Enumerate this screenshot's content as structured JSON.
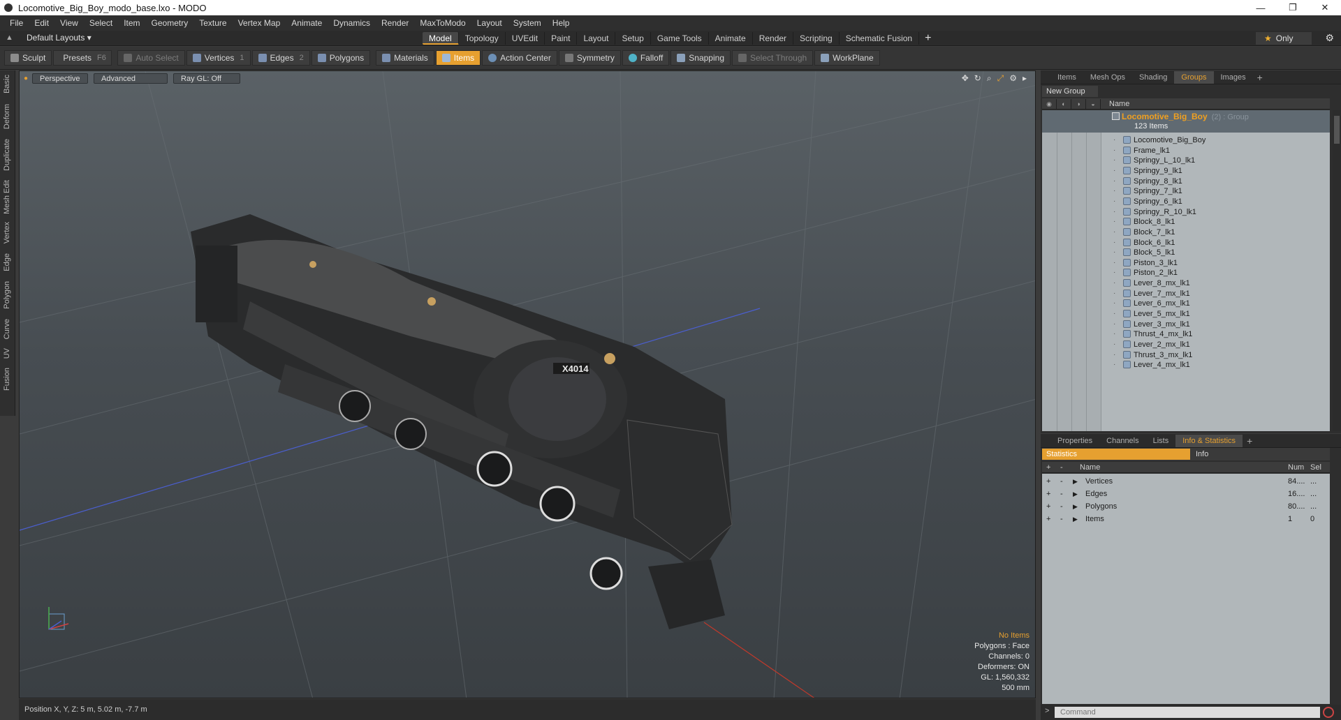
{
  "window": {
    "title": "Locomotive_Big_Boy_modo_base.lxo - MODO",
    "controls": [
      "—",
      "❐",
      "✕"
    ]
  },
  "menubar": [
    "File",
    "Edit",
    "View",
    "Select",
    "Item",
    "Geometry",
    "Texture",
    "Vertex Map",
    "Animate",
    "Dynamics",
    "Render",
    "MaxToModo",
    "Layout",
    "System",
    "Help"
  ],
  "layoutbar": {
    "layout_select": "Default Layouts ▾",
    "tabs": [
      "Model",
      "Topology",
      "UVEdit",
      "Paint",
      "Layout",
      "Setup",
      "Game Tools",
      "Animate",
      "Render",
      "Scripting",
      "Schematic Fusion"
    ],
    "active_tab": "Model",
    "add_tab": "+",
    "only_label": "Only"
  },
  "toolbar": {
    "sculpt": "Sculpt",
    "presets": "Presets",
    "presets_key": "F6",
    "auto_select": "Auto Select",
    "vertices": "Vertices",
    "vertices_key": "1",
    "edges": "Edges",
    "edges_key": "2",
    "polygons": "Polygons",
    "materials": "Materials",
    "items": "Items",
    "action_center": "Action Center",
    "symmetry": "Symmetry",
    "falloff": "Falloff",
    "snapping": "Snapping",
    "select_through": "Select Through",
    "workplane": "WorkPlane"
  },
  "left_tabs": [
    "Basic",
    "Deform",
    "Duplicate",
    "Mesh Edit",
    "Vertex",
    "Edge",
    "Polygon",
    "Curve",
    "UV",
    "Fusion"
  ],
  "viewport": {
    "perspective": "Perspective",
    "advanced": "Advanced",
    "raygl": "Ray GL: Off",
    "model_number": "X4014",
    "info": {
      "no_items": "No Items",
      "polygons": "Polygons : Face",
      "channels": "Channels: 0",
      "deformers": "Deformers: ON",
      "gl": "GL: 1,560,332",
      "scale": "500 mm"
    }
  },
  "statusbar": {
    "position": "Position X, Y, Z:   5 m, 5.02 m, -7.7 m"
  },
  "items_panel": {
    "tabs": [
      "Items",
      "Mesh Ops",
      "Shading",
      "Groups",
      "Images"
    ],
    "active_tab": "Groups",
    "new_group": "New Group",
    "column_name": "Name",
    "group": {
      "name": "Locomotive_Big_Boy",
      "meta": "(2) : Group",
      "count": "123 Items"
    },
    "items": [
      "Locomotive_Big_Boy",
      "Frame_lk1",
      "Springy_L_10_lk1",
      "Springy_9_lk1",
      "Springy_8_lk1",
      "Springy_7_lk1",
      "Springy_6_lk1",
      "Springy_R_10_lk1",
      "Block_8_lk1",
      "Block_7_lk1",
      "Block_6_lk1",
      "Block_5_lk1",
      "Piston_3_lk1",
      "Piston_2_lk1",
      "Lever_8_mx_lk1",
      "Lever_7_mx_lk1",
      "Lever_6_mx_lk1",
      "Lever_5_mx_lk1",
      "Lever_3_mx_lk1",
      "Thrust_4_mx_lk1",
      "Lever_2_mx_lk1",
      "Thrust_3_mx_lk1",
      "Lever_4_mx_lk1"
    ]
  },
  "props_panel": {
    "tabs": [
      "Properties",
      "Channels",
      "Lists",
      "Info & Statistics"
    ],
    "active_tab": "Info & Statistics",
    "stat_tab": "Statistics",
    "info_tab": "Info",
    "headers": {
      "name": "Name",
      "num": "Num",
      "sel": "Sel"
    },
    "rows": [
      {
        "name": "Vertices",
        "num": "84....",
        "sel": "..."
      },
      {
        "name": "Edges",
        "num": "16....",
        "sel": "..."
      },
      {
        "name": "Polygons",
        "num": "80....",
        "sel": "..."
      },
      {
        "name": "Items",
        "num": "1",
        "sel": "0"
      }
    ],
    "command_prompt": ">",
    "command_placeholder": "Command"
  },
  "colors": {
    "accent": "#e6a030",
    "viewport_top": "#5a6166",
    "viewport_bottom": "#3a3f43",
    "list_bg": "#b1b7ba"
  }
}
